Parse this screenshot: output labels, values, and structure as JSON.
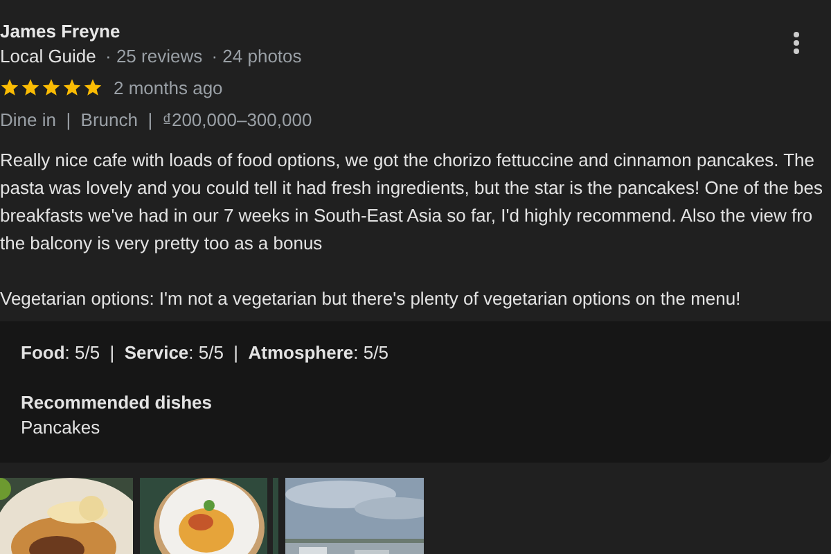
{
  "reviewer": {
    "name": "James Freyne",
    "badge": "Local Guide",
    "reviews": "· 25 reviews",
    "photos": "· 24 photos"
  },
  "stars": 5,
  "time": "2 months ago",
  "tags": "Dine in  |  Brunch  |  ₫200,000–300,000",
  "review_lines": [
    "Really nice cafe with loads of food options, we got the chorizo fettuccine and cinnamon pancakes. The",
    "pasta was lovely and you could tell it had fresh ingredients, but the star is the pancakes! One of the bes",
    "breakfasts we've had in our 7 weeks in South-East Asia so far, I'd highly recommend. Also the view fro",
    "the balcony is very pretty too as a bonus"
  ],
  "vegetarian": "Vegetarian options: I'm not a vegetarian but there's plenty of vegetarian options on the menu!",
  "ratings": "**Food**: 5/5  |  **Service**: 5/5  |  **Atmosphere**: 5/5",
  "recommended": {
    "title": "Recommended dishes",
    "value": "Pancakes"
  },
  "photos": [
    {
      "kind": "pancake"
    },
    {
      "kind": "plate"
    },
    {
      "kind": "city"
    }
  ]
}
